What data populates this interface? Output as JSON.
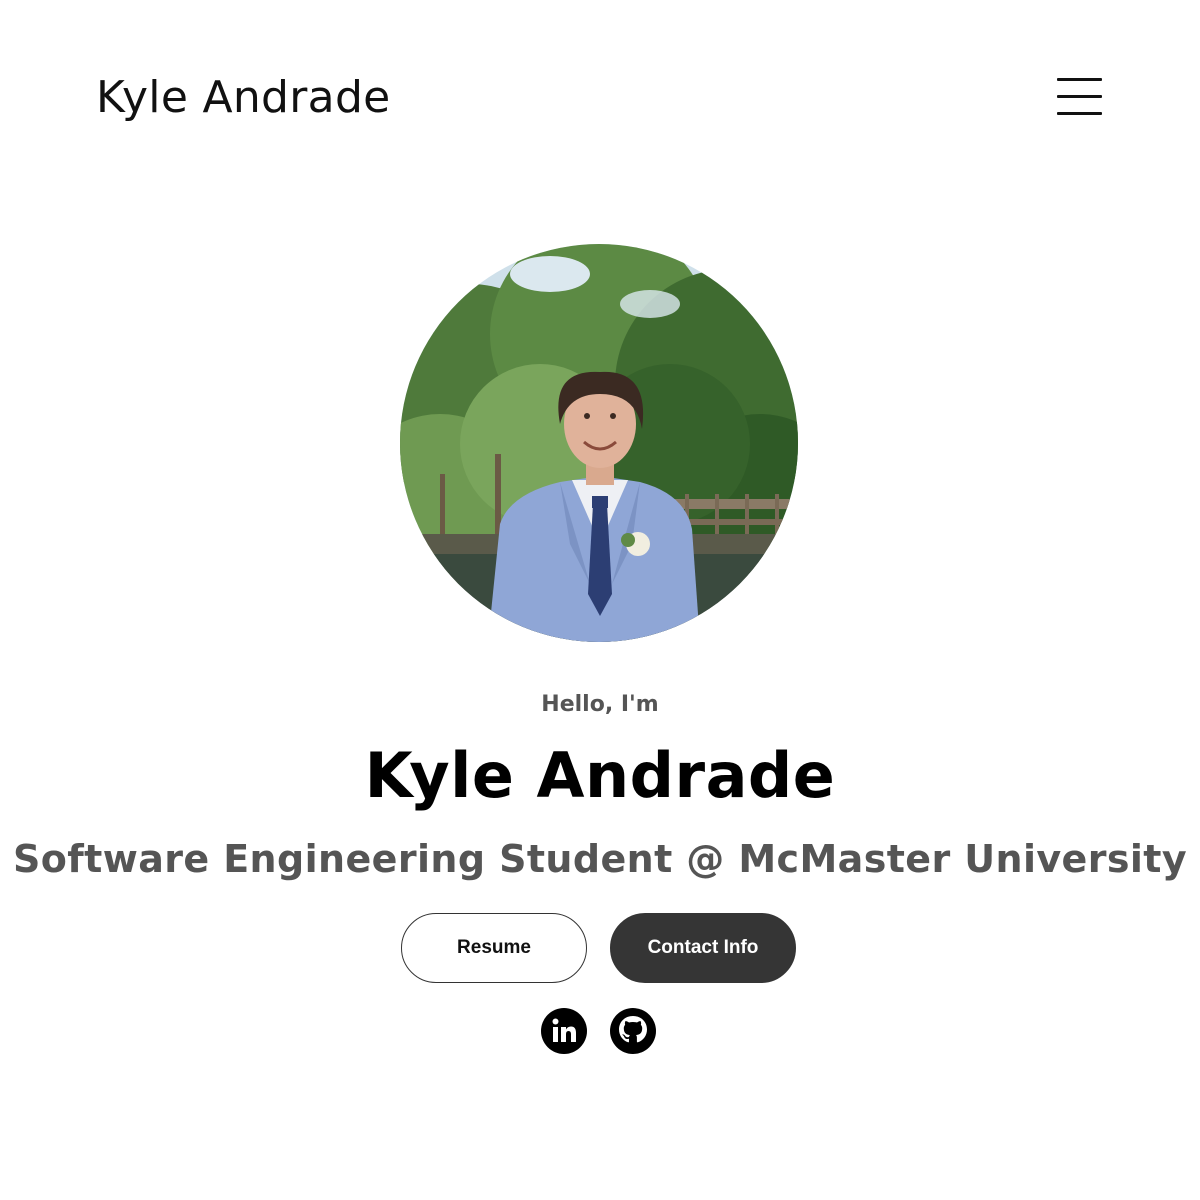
{
  "header": {
    "logo_text": "Kyle Andrade",
    "menu_icon": "hamburger-menu-icon"
  },
  "profile": {
    "photo_alt": "Profile picture of Kyle Andrade",
    "greeting": "Hello, I'm",
    "name": "Kyle Andrade",
    "subtitle": "Software Engineering Student @ McMaster University"
  },
  "buttons": {
    "resume_label": "Resume",
    "contact_label": "Contact Info"
  },
  "social": {
    "linkedin_label": "My LinkedIn profile",
    "linkedin_icon": "linkedin-icon",
    "github_label": "My Git profile",
    "github_icon": "github-icon"
  },
  "colors": {
    "text_primary": "#000000",
    "text_secondary": "#555555",
    "button_dark": "#353535",
    "background": "#ffffff"
  }
}
